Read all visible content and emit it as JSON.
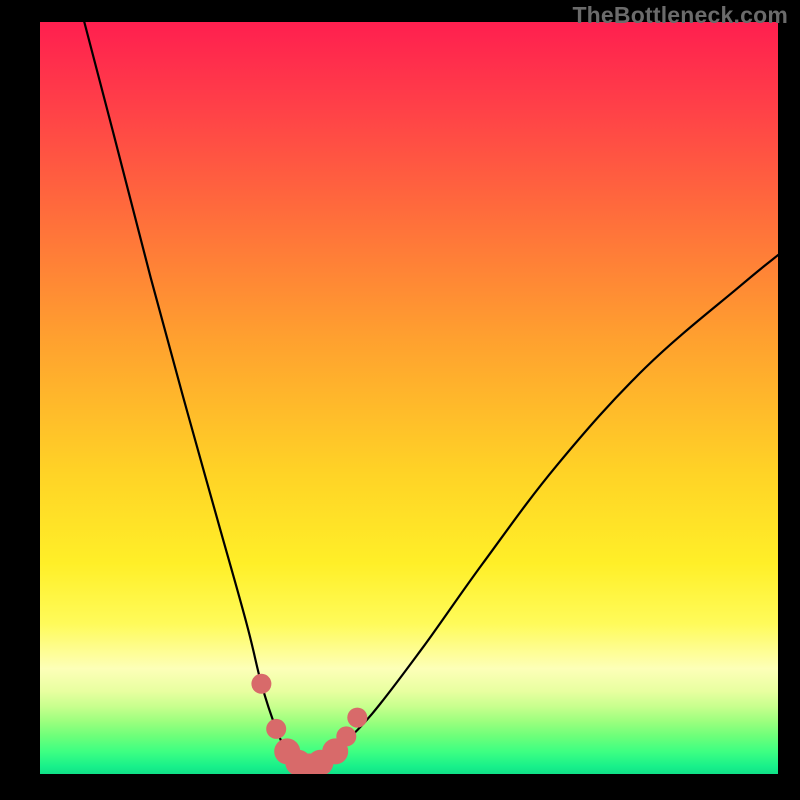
{
  "watermark": "TheBottleneck.com",
  "chart_data": {
    "type": "line",
    "title": "",
    "xlabel": "",
    "ylabel": "",
    "xlim": [
      0,
      100
    ],
    "ylim": [
      0,
      100
    ],
    "grid": false,
    "series": [
      {
        "name": "bottleneck-curve",
        "x": [
          6,
          10,
          15,
          20,
          24,
          28,
          30,
          32,
          33.5,
          35,
          36.5,
          38,
          40,
          45,
          52,
          60,
          70,
          82,
          95,
          100
        ],
        "values": [
          100,
          85,
          66,
          48,
          34,
          20,
          12,
          6,
          3,
          1.5,
          1,
          1.5,
          3,
          8,
          17,
          28,
          41,
          54,
          65,
          69
        ]
      }
    ],
    "markers": {
      "name": "highlight-points",
      "x": [
        30,
        32,
        33.5,
        35,
        36.5,
        38,
        40,
        41.5,
        43
      ],
      "values": [
        12,
        6,
        3,
        1.5,
        1,
        1.5,
        3,
        5,
        7.5
      ],
      "radius": [
        10,
        10,
        13,
        13,
        13,
        13,
        13,
        10,
        10
      ],
      "color": "#d86a6a"
    },
    "curve_minimum_x": 36.5
  }
}
